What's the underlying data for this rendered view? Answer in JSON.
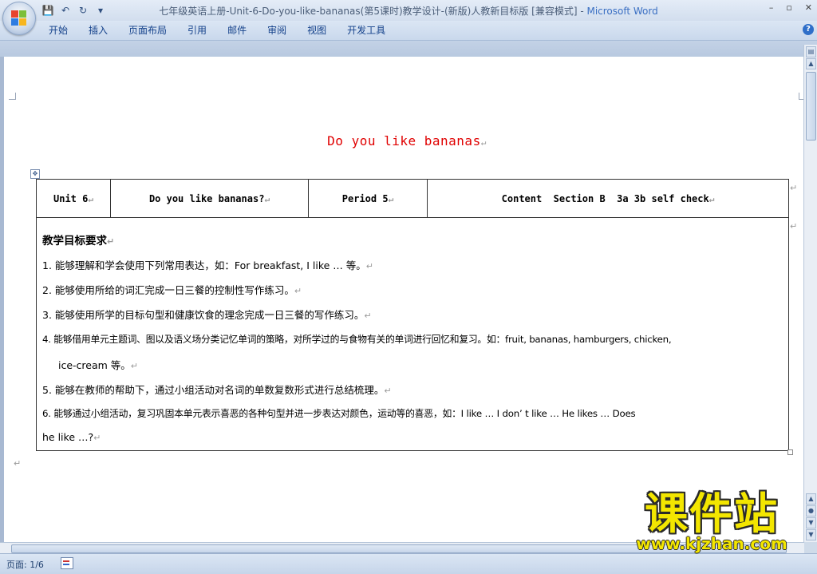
{
  "window": {
    "title": "七年级英语上册-Unit-6-Do-you-like-bananas(第5课时)教学设计-(新版)人教新目标版 [兼容模式] - ",
    "app_name": "Microsoft Word"
  },
  "ribbon": {
    "tabs": [
      "开始",
      "插入",
      "页面布局",
      "引用",
      "邮件",
      "审阅",
      "视图",
      "开发工具"
    ]
  },
  "document": {
    "title": "Do you like bananas",
    "table": {
      "header": [
        "Unit 6",
        "Do you like bananas?",
        "Period 5",
        "Content  Section B  3a 3b self check"
      ],
      "heading": "教学目标要求",
      "items": [
        "1. 能够理解和学会使用下列常用表达，如：For breakfast, I like … 等。",
        "2. 能够使用所给的词汇完成一日三餐的控制性写作练习。",
        "3. 能够使用所学的目标句型和健康饮食的理念完成一日三餐的写作练习。",
        "4. 能够借用单元主题词、图以及语义场分类记忆单词的策略，对所学过的与食物有关的单词进行回忆和复习。如：fruit, bananas, hamburgers, chicken,",
        "ice-cream 等。",
        "5. 能够在教师的帮助下，通过小组活动对名词的单数复数形式进行总结梳理。",
        "6. 能够通过小组活动，复习巩固本单元表示喜恶的各种句型并进一步表达对颜色，运动等的喜恶，如：I like … I don’ t like … He likes … Does",
        "he like …?"
      ]
    }
  },
  "statusbar": {
    "page": "页面: 1/6"
  },
  "watermark": {
    "name": "课件站",
    "url": "www.kjzhan.com"
  }
}
